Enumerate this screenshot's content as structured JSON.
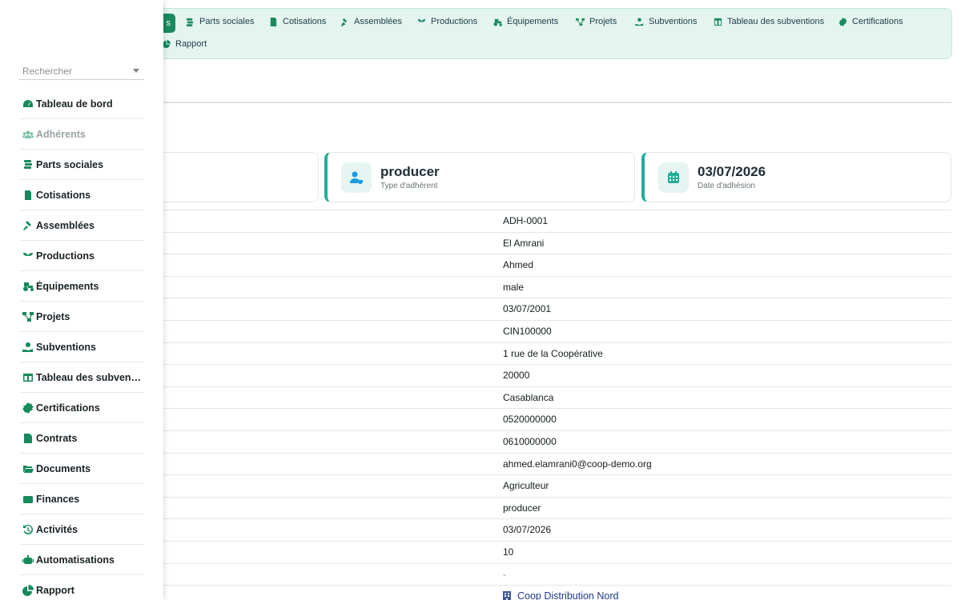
{
  "topnav": {
    "active_label": "s",
    "items": [
      {
        "label": "Parts sociales",
        "icon": "coins-icon"
      },
      {
        "label": "Cotisations",
        "icon": "invoice-icon"
      },
      {
        "label": "Assemblées",
        "icon": "gavel-icon"
      },
      {
        "label": "Productions",
        "icon": "seedling-icon"
      },
      {
        "label": "Équipements",
        "icon": "tractor-icon"
      },
      {
        "label": "Projets",
        "icon": "project-diagram-icon"
      },
      {
        "label": "Subventions",
        "icon": "hand-holding-icon"
      },
      {
        "label": "Tableau des subventions",
        "icon": "table-icon"
      },
      {
        "label": "Certifications",
        "icon": "certificate-icon"
      },
      {
        "label": "Rapport",
        "icon": "pie-chart-icon"
      }
    ]
  },
  "cards": [
    {
      "value": "producer",
      "label": "Type d'adhérent",
      "icon": "user-tag-icon"
    },
    {
      "value": "03/07/2026",
      "label": "Date d'adhésion",
      "icon": "calendar-icon"
    }
  ],
  "details": [
    "ADH-0001",
    "El Amrani",
    "Ahmed",
    "male",
    "03/07/2001",
    "CIN100000",
    "1 rue de la Coopérative",
    "20000",
    "Casablanca",
    "0520000000",
    "0610000000",
    "ahmed.elamrani0@coop-demo.org",
    "Agriculteur",
    "producer",
    "03/07/2026",
    "10",
    "-",
    "Coop Distribution Nord"
  ],
  "sidebar": {
    "search_placeholder": "Rechercher",
    "items": [
      {
        "label": "Tableau de bord",
        "icon": "dashboard-icon"
      },
      {
        "label": "Adhérents",
        "icon": "users-icon",
        "disabled": true
      },
      {
        "label": "Parts sociales",
        "icon": "coins-icon"
      },
      {
        "label": "Cotisations",
        "icon": "invoice-icon"
      },
      {
        "label": "Assemblées",
        "icon": "gavel-icon"
      },
      {
        "label": "Productions",
        "icon": "seedling-icon"
      },
      {
        "label": "Équipements",
        "icon": "tractor-icon"
      },
      {
        "label": "Projets",
        "icon": "project-diagram-icon"
      },
      {
        "label": "Subventions",
        "icon": "hand-holding-icon"
      },
      {
        "label": "Tableau des subventions",
        "icon": "table-icon"
      },
      {
        "label": "Certifications",
        "icon": "certificate-icon"
      },
      {
        "label": "Contrats",
        "icon": "file-signature-icon"
      },
      {
        "label": "Documents",
        "icon": "folder-open-icon"
      },
      {
        "label": "Finances",
        "icon": "wallet-icon"
      },
      {
        "label": "Activités",
        "icon": "history-icon"
      },
      {
        "label": "Automatisations",
        "icon": "robot-icon"
      },
      {
        "label": "Rapport",
        "icon": "pie-chart-icon"
      }
    ]
  },
  "colors": {
    "accent": "#1a8a5e",
    "card_border": "#1fae9a",
    "topnav_bg": "#e3f5ee"
  }
}
